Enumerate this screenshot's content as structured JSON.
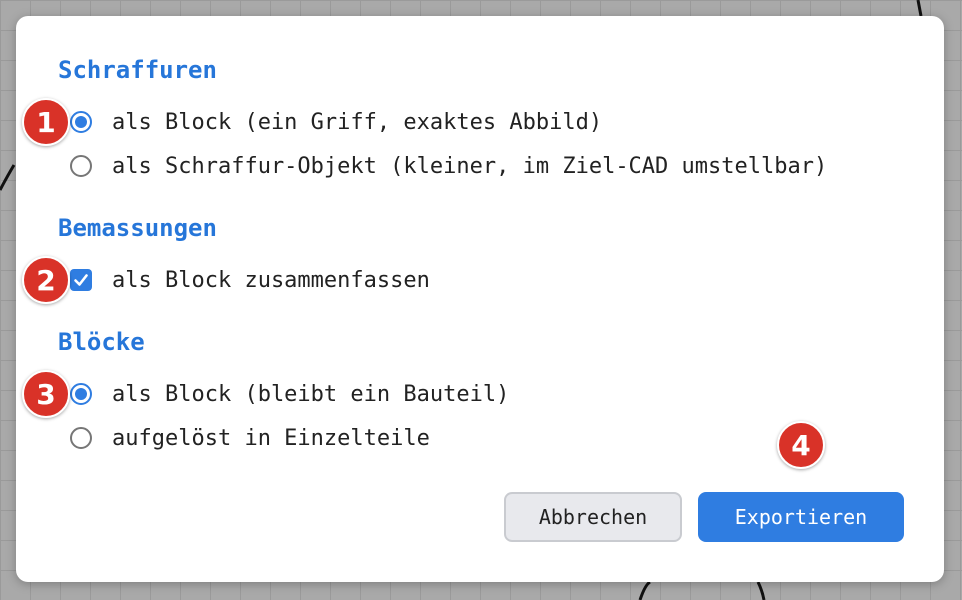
{
  "dialog": {
    "sections": [
      {
        "title": "Schraffuren",
        "options": [
          {
            "label": "als Block (ein Griff, exaktes Abbild)",
            "type": "radio",
            "checked": true
          },
          {
            "label": "als Schraffur-Objekt (kleiner, im Ziel-CAD umstellbar)",
            "type": "radio",
            "checked": false
          }
        ]
      },
      {
        "title": "Bemassungen",
        "options": [
          {
            "label": "als Block zusammenfassen",
            "type": "checkbox",
            "checked": true
          }
        ]
      },
      {
        "title": "Blöcke",
        "options": [
          {
            "label": "als Block (bleibt ein Bauteil)",
            "type": "radio",
            "checked": true
          },
          {
            "label": "aufgelöst in Einzelteile",
            "type": "radio",
            "checked": false
          }
        ]
      }
    ],
    "buttons": {
      "cancel": "Abbrechen",
      "export": "Exportieren"
    }
  },
  "badges": [
    "1",
    "2",
    "3",
    "4"
  ],
  "colors": {
    "accent": "#2f7de1",
    "section_title": "#2676d9",
    "badge": "#d93228",
    "backdrop": "#a9a9a9"
  },
  "icons": {
    "checkbox_checked": "checkmark-icon"
  }
}
